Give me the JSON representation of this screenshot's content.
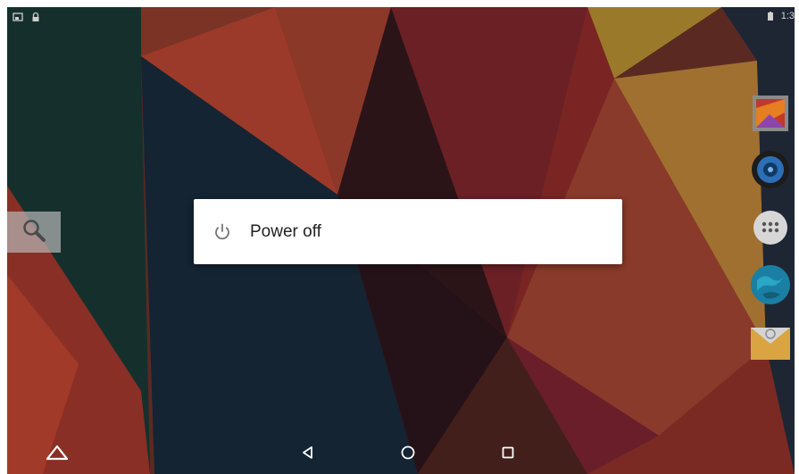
{
  "status_bar": {
    "left_icons": [
      "screenshot-icon",
      "lock-icon"
    ],
    "right_icons": [
      "battery-icon"
    ],
    "clock": "1:3"
  },
  "power_menu": {
    "items": [
      {
        "label": "Power off",
        "icon": "power-icon"
      }
    ]
  },
  "home_screen": {
    "search_widget_icon": "magnifier-icon",
    "dock_icons": [
      "gallery-icon",
      "music-icon",
      "app-drawer-icon",
      "browser-icon",
      "email-icon"
    ]
  },
  "navigation_bar": {
    "buttons": [
      "up-arrow-icon",
      "back-icon",
      "home-icon",
      "recents-icon"
    ]
  },
  "colors": {
    "menu_background": "#ffffff",
    "menu_text": "#212121",
    "icon_grey": "#757575"
  }
}
